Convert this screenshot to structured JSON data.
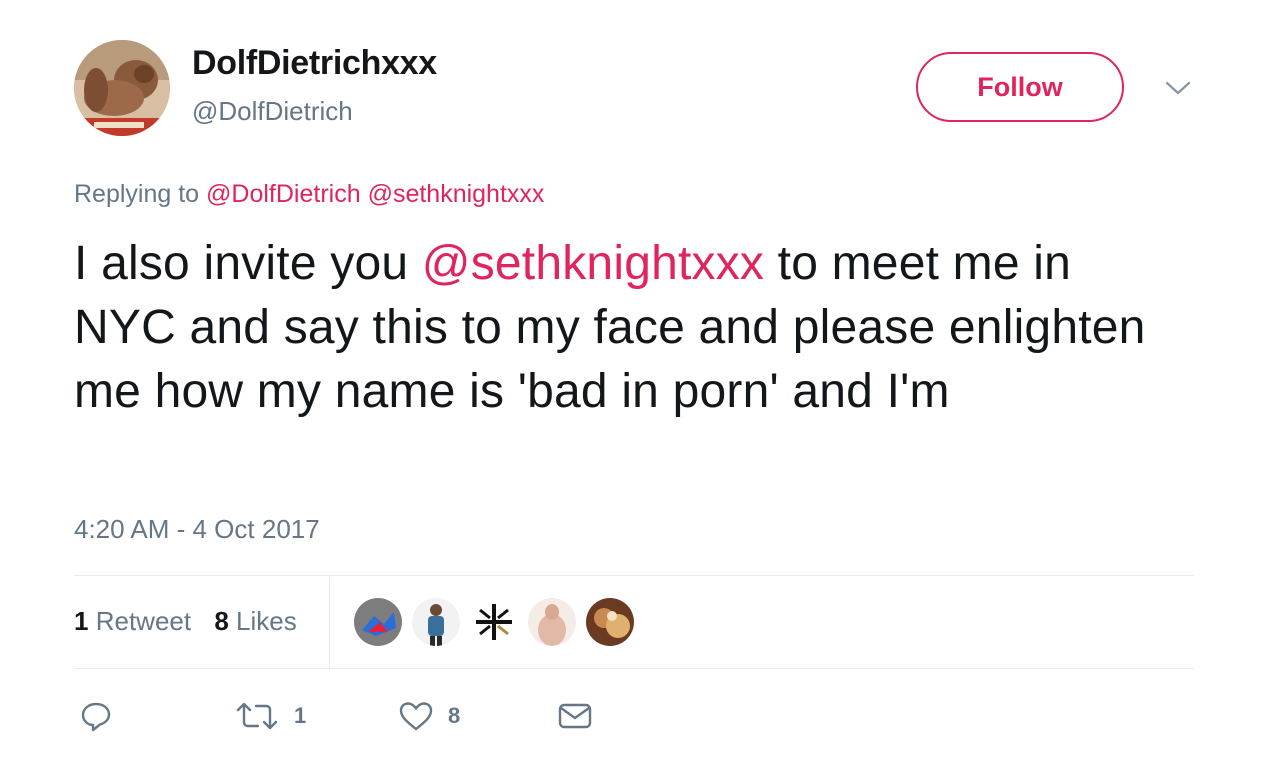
{
  "user": {
    "display_name": "DolfDietrichxxx",
    "handle": "@DolfDietrich"
  },
  "follow_button": {
    "label": "Follow"
  },
  "reply_context": {
    "prefix": "Replying to",
    "mentions": [
      "@DolfDietrich",
      "@sethknightxxx"
    ]
  },
  "tweet": {
    "text_before": "I also invite you ",
    "mention": "@sethknightxxx",
    "text_after": " to meet me in NYC and say this to my face and please enlighten me how my name is 'bad in porn' and I'm",
    "timestamp": "4:20 AM - 4 Oct 2017"
  },
  "stats": {
    "retweets_count": "1",
    "retweets_label": "Retweet",
    "likes_count": "8",
    "likes_label": "Likes"
  },
  "liker_avatars": [
    "liker-avatar-1",
    "liker-avatar-2",
    "liker-avatar-3",
    "liker-avatar-4",
    "liker-avatar-5"
  ],
  "actions": {
    "reply_icon": "reply-icon",
    "retweet_icon": "retweet-icon",
    "retweet_count": "1",
    "like_icon": "heart-icon",
    "like_count": "8",
    "dm_icon": "envelope-icon"
  },
  "colors": {
    "accent": "#e0245e",
    "secondary_text": "#657786",
    "primary_text": "#14171a",
    "divider": "#e6ecf0"
  }
}
